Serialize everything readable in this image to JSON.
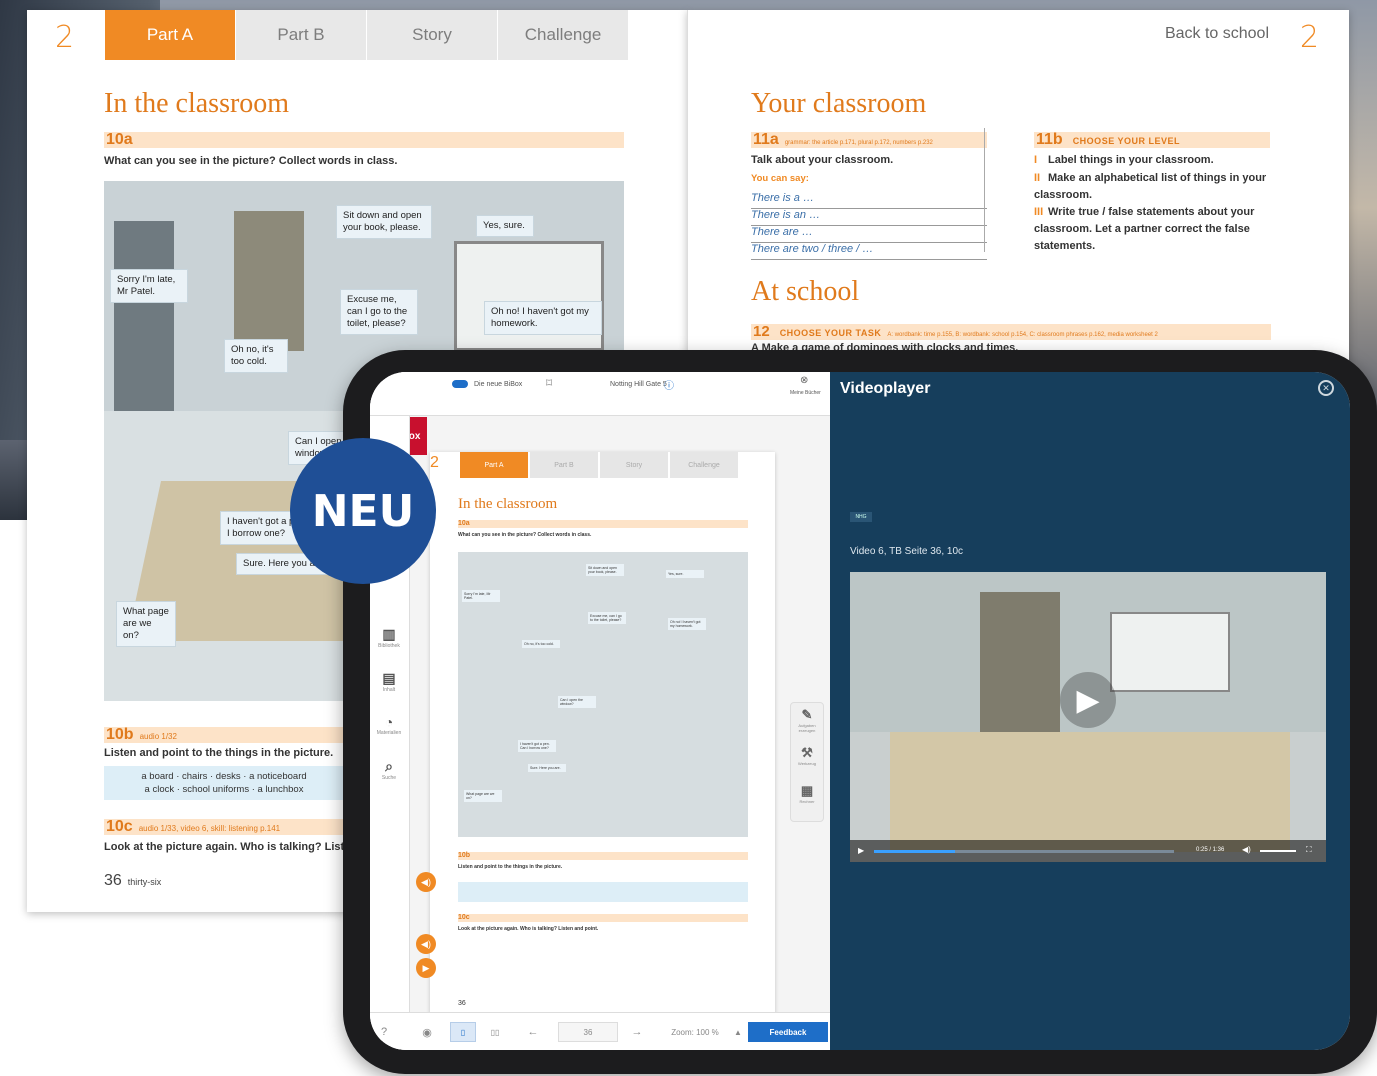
{
  "book": {
    "unit_number": "2",
    "tabs": [
      "Part A",
      "Part B",
      "Story",
      "Challenge"
    ],
    "left": {
      "title": "In the classroom",
      "task_10a": "10a",
      "instr_10a": "What can you see in the picture? Collect words in class.",
      "bubbles": [
        "Sorry I'm late, Mr Patel.",
        "Sit down and open your book, please.",
        "Yes, sure.",
        "Excuse me, can I go to the toilet, please?",
        "Oh no! I haven't got my homework.",
        "Oh no, it's too cold.",
        "Can I open the window?",
        "I haven't got a pen. Can I borrow one?",
        "Sure. Here you are.",
        "What page are we on?"
      ],
      "task_10b": "10b",
      "ref_10b": "audio 1/32",
      "instr_10b": "Listen and point to the things in the picture.",
      "words_line1": "a board · chairs · desks · a noticeboard",
      "words_line2": "a clock · school uniforms · a lunchbox",
      "task_10c": "10c",
      "ref_10c": "audio 1/33, video 6, skill: listening p.141",
      "instr_10c": "Look at the picture again. Who is talking? Listen and point.",
      "page_number": "36",
      "page_words": "thirty-six"
    },
    "right": {
      "header": "Back to school",
      "unit_number": "2",
      "title": "Your classroom",
      "task_11a": "11a",
      "ref_11a": "grammar: the article p.171, plural p.172, numbers p.232",
      "instr_11a": "Talk about your classroom.",
      "you_can_say": "You can say:",
      "phrases": [
        "There is a …",
        "There is an …",
        "There are …",
        "There are two / three / …"
      ],
      "task_11b": "11b",
      "level_11b": "CHOOSE YOUR LEVEL",
      "levels": [
        {
          "marker": "I",
          "text": "Label things in your classroom."
        },
        {
          "marker": "II",
          "text": "Make an alphabetical list of things in your classroom."
        },
        {
          "marker": "III",
          "text": "Write true / false statements about your classroom. Let a partner correct the false statements."
        }
      ],
      "title2": "At school",
      "task_12": "12",
      "level_12": "CHOOSE YOUR TASK",
      "ref_12": "A: wordbank: time p.155, B: wordbank: school p.154, C: classroom phrases p.162, media worksheet 2",
      "task_12_a": "A  Make a game of dominoes with clocks and times."
    }
  },
  "badge": "NEU",
  "tablet": {
    "logo": "BiBox",
    "top_toggle": "Die neue BiBox",
    "top_book": "Notting Hill Gate 5",
    "top_right": "Meine Bücher",
    "side_icons": [
      {
        "icon": "library-icon",
        "glyph": "▥",
        "label": "Bibliothek"
      },
      {
        "icon": "book-icon",
        "glyph": "▤",
        "label": "Inhalt"
      },
      {
        "icon": "materials-icon",
        "glyph": "◔",
        "label": "Materialien"
      },
      {
        "icon": "search-icon",
        "glyph": "⌕",
        "label": "Suche"
      }
    ],
    "right_tools": [
      {
        "icon": "edit-icon",
        "glyph": "✎",
        "label": "Aufgaben erzeugen"
      },
      {
        "icon": "tools-icon",
        "glyph": "⚒",
        "label": "Werkzeug"
      },
      {
        "icon": "calculator-icon",
        "glyph": "▦",
        "label": "Rechner"
      }
    ],
    "mini_unit": "2",
    "mini_tabs": [
      "Part A",
      "Part B",
      "Story",
      "Challenge"
    ],
    "mini_title": "In the classroom",
    "mini_page": "36",
    "page_input": "36",
    "zoom": "Zoom: 100 %",
    "feedback": "Feedback",
    "video_title": "Videoplayer",
    "video_tag": "NHG",
    "video_caption": "Video 6, TB Seite 36, 10c",
    "video_time": "0:25 / 1:36",
    "video_progress": 0.27
  }
}
